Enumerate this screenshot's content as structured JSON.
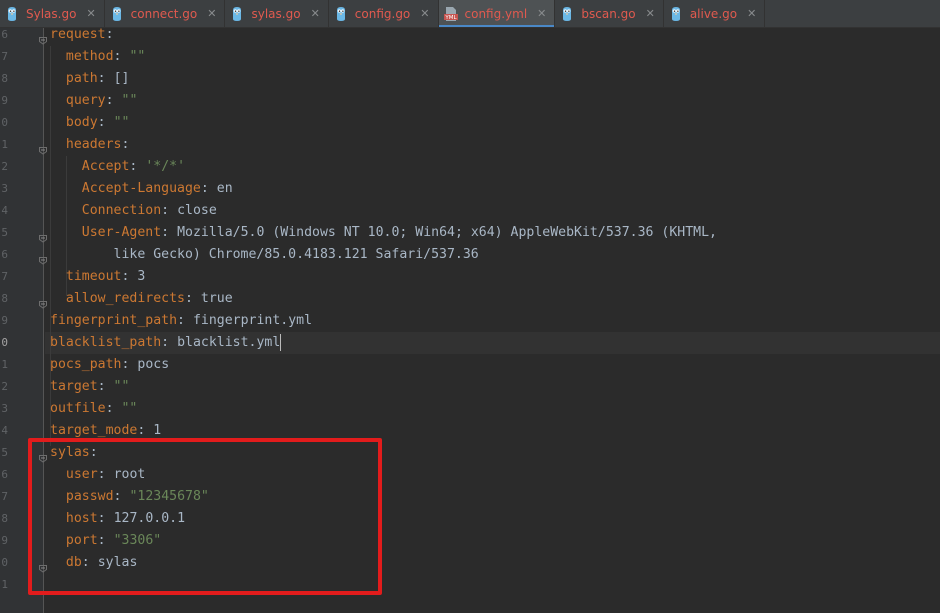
{
  "tabs": [
    {
      "label": "Sylas.go",
      "icon": "go-file-icon",
      "active": false
    },
    {
      "label": "connect.go",
      "icon": "go-file-icon",
      "active": false
    },
    {
      "label": "sylas.go",
      "icon": "go-file-icon",
      "active": false
    },
    {
      "label": "config.go",
      "icon": "go-file-icon",
      "active": false
    },
    {
      "label": "config.yml",
      "icon": "yaml-file-icon",
      "active": true
    },
    {
      "label": "bscan.go",
      "icon": "go-file-icon",
      "active": false
    },
    {
      "label": "alive.go",
      "icon": "go-file-icon",
      "active": false
    }
  ],
  "tab_close_glyph": "✕",
  "yaml_icon_text": "YML",
  "colors": {
    "background": "#2b2b2b",
    "gutter": "#313335",
    "key": "#cc7832",
    "string": "#6a8759",
    "value": "#a9b7c6",
    "tab_label": "#e05a4f",
    "highlight_border": "#e21c1c",
    "active_tab_underline": "#4a88c7"
  },
  "gutter": {
    "line_numbers": [
      "6",
      "7",
      "8",
      "9",
      "0",
      "1",
      "2",
      "3",
      "4",
      "5",
      "6",
      "7",
      "8",
      "9",
      "0",
      "1",
      "2",
      "3",
      "4",
      "5",
      "6",
      "7",
      "8",
      "9",
      "0",
      "1"
    ]
  },
  "editor": {
    "current_line": 14,
    "lines": [
      {
        "indent": 0,
        "key": "request",
        "fold": true
      },
      {
        "indent": 1,
        "key": "method",
        "value": "\"\"",
        "value_type": "string"
      },
      {
        "indent": 1,
        "key": "path",
        "value": "[]",
        "value_type": "plain"
      },
      {
        "indent": 1,
        "key": "query",
        "value": "\"\"",
        "value_type": "string"
      },
      {
        "indent": 1,
        "key": "body",
        "value": "\"\"",
        "value_type": "string"
      },
      {
        "indent": 1,
        "key": "headers",
        "fold": true
      },
      {
        "indent": 2,
        "key": "Accept",
        "value": "'*/*'",
        "value_type": "string"
      },
      {
        "indent": 2,
        "key": "Accept-Language",
        "value": "en",
        "value_type": "plain"
      },
      {
        "indent": 2,
        "key": "Connection",
        "value": "close",
        "value_type": "plain"
      },
      {
        "indent": 2,
        "key": "User-Agent",
        "value": "Mozilla/5.0 (Windows NT 10.0; Win64; x64) AppleWebKit/537.36 (KHTML,",
        "value_type": "plain",
        "fold": true
      },
      {
        "indent": 0,
        "continuation": "        like Gecko) Chrome/85.0.4183.121 Safari/537.36",
        "fold": true
      },
      {
        "indent": 1,
        "key": "timeout",
        "value": "3",
        "value_type": "plain"
      },
      {
        "indent": 1,
        "key": "allow_redirects",
        "value": "true",
        "value_type": "plain",
        "fold": true
      },
      {
        "indent": 0,
        "key": "fingerprint_path",
        "value": "fingerprint.yml",
        "value_type": "plain"
      },
      {
        "indent": 0,
        "key": "blacklist_path",
        "value": "blacklist.yml",
        "value_type": "plain",
        "caret": true
      },
      {
        "indent": 0,
        "key": "pocs_path",
        "value": "pocs",
        "value_type": "plain"
      },
      {
        "indent": 0,
        "key": "target",
        "value": "\"\"",
        "value_type": "string"
      },
      {
        "indent": 0,
        "key": "outfile",
        "value": "\"\"",
        "value_type": "string"
      },
      {
        "indent": 0,
        "key": "target_mode",
        "value": "1",
        "value_type": "plain"
      },
      {
        "indent": 0,
        "key": "sylas",
        "fold": true
      },
      {
        "indent": 1,
        "key": "user",
        "value": "root",
        "value_type": "plain"
      },
      {
        "indent": 1,
        "key": "passwd",
        "value": "\"12345678\"",
        "value_type": "string"
      },
      {
        "indent": 1,
        "key": "host",
        "value": "127.0.0.1",
        "value_type": "plain"
      },
      {
        "indent": 1,
        "key": "port",
        "value": "\"3306\"",
        "value_type": "string"
      },
      {
        "indent": 1,
        "key": "db",
        "value": "sylas",
        "value_type": "plain",
        "fold": true
      },
      {
        "indent": 0,
        "empty": true
      }
    ]
  }
}
